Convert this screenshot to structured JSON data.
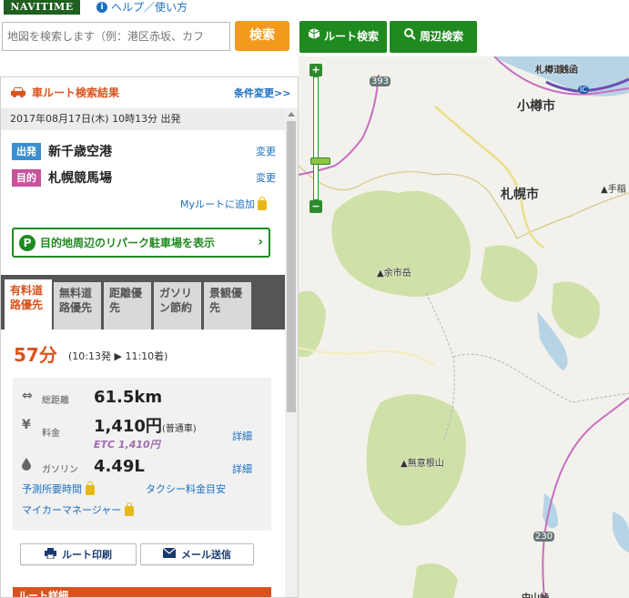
{
  "header": {
    "logo": "NAVITIME",
    "help_link": "ヘルプ／使い方",
    "search_placeholder": "地図を検索します（例：港区赤坂、カフ",
    "search_button": "検索",
    "route_search": "ルート検索",
    "nearby_search": "周辺検索"
  },
  "panel": {
    "title": "車ルート検索結果",
    "condition_change": "条件変更>>",
    "datetime": "2017年08月17日(木) 10時13分 出発",
    "departure": {
      "tag": "出発",
      "name": "新千歳空港",
      "change": "変更"
    },
    "destination": {
      "tag": "目的",
      "name": "札幌競馬場",
      "change": "変更"
    },
    "my_route": "Myルートに追加",
    "parking_label": "目的地周辺のリパーク駐車場を表示",
    "tabs": [
      {
        "line1": "有料道",
        "line2": "路優先"
      },
      {
        "line1": "無料道",
        "line2": "路優先"
      },
      {
        "line1": "距離優",
        "line2": "先"
      },
      {
        "line1": "ガソリ",
        "line2": "ン節約"
      },
      {
        "line1": "景観優",
        "line2": "先"
      }
    ],
    "duration": "57分",
    "times": "(10:13発 ▶ 11:10着)",
    "distance_label": "総距離",
    "distance_value": "61.5km",
    "fee_label": "料金",
    "fee_value": "1,410円",
    "fee_type": "(普通車)",
    "etc_value": "ETC 1,410円",
    "fee_detail": "詳細",
    "gas_label": "ガソリン",
    "gas_value": "4.49L",
    "gas_detail": "詳細",
    "forecast_link": "予測所要時間",
    "taxi_link": "タクシー料金目安",
    "mycar_link": "マイカーマネージャー",
    "print_button": "ルート印刷",
    "mail_button": "メール送信",
    "route_detail": "ルート詳細"
  },
  "map": {
    "labels": {
      "otaru": "小樽市",
      "sapporo": "札幌市",
      "yoichidake": "余市岳",
      "muinenzan": "無意根山",
      "teine": "手稲",
      "otaru_road": "札樽道",
      "zenibako": "銭函",
      "route_393": "393",
      "route_230": "230",
      "ic": "IC",
      "nakayama": "中山峠"
    },
    "zoom_in": "+",
    "zoom_out": "−"
  },
  "colors": {
    "accent_orange": "#d9531e",
    "brand_green": "#1f8a1f",
    "link_blue": "#1a6fc0",
    "route_purple": "#c8529b"
  }
}
